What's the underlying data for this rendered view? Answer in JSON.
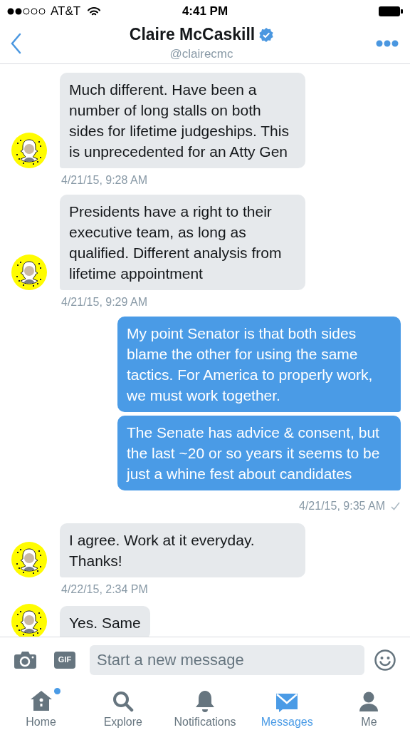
{
  "status_bar": {
    "carrier": "AT&T",
    "time": "4:41 PM"
  },
  "header": {
    "name": "Claire McCaskill",
    "verified": true,
    "handle": "@clairecmc"
  },
  "messages": [
    {
      "kind": "incoming",
      "text": "Much different. Have been a number of long stalls on both sides for lifetime judgeships. This is unprecedented for an Atty Gen",
      "timestamp": "4/21/15, 9:28 AM"
    },
    {
      "kind": "incoming",
      "text": "Presidents have a right to their executive team, as long as qualified. Different analysis from lifetime appointment",
      "timestamp": "4/21/15, 9:29 AM"
    },
    {
      "kind": "outgoing",
      "text": "My point Senator is that both sides blame the other for using the same tactics. For America to properly work, we must work together."
    },
    {
      "kind": "outgoing",
      "text": "The Senate has advice & consent, but the last ~20 or so years it seems to be just a whine fest about candidates",
      "timestamp": "4/21/15, 9:35 AM",
      "delivered": true
    },
    {
      "kind": "incoming",
      "text": "I agree. Work at it everyday. Thanks!",
      "timestamp": "4/22/15, 2:34 PM"
    },
    {
      "kind": "incoming",
      "text": "Yes. Same"
    }
  ],
  "composer": {
    "placeholder": "Start a new message",
    "gif_label": "GIF"
  },
  "tabs": [
    {
      "kind": "home",
      "label": "Home",
      "selected": false,
      "badge": true
    },
    {
      "kind": "explore",
      "label": "Explore",
      "selected": false,
      "badge": false
    },
    {
      "kind": "notifications",
      "label": "Notifications",
      "selected": false,
      "badge": false
    },
    {
      "kind": "messages",
      "label": "Messages",
      "selected": true,
      "badge": false
    },
    {
      "kind": "me",
      "label": "Me",
      "selected": false,
      "badge": false
    }
  ]
}
